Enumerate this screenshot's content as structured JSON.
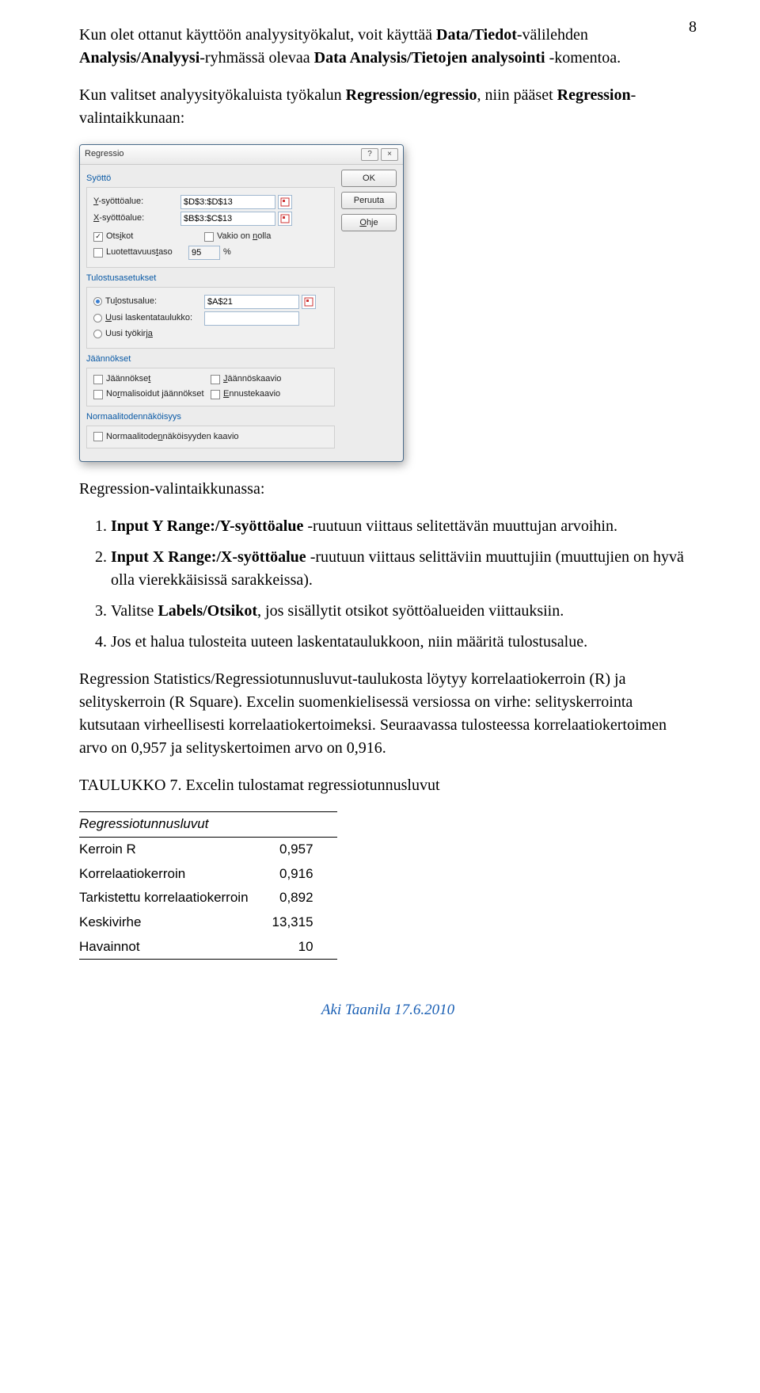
{
  "pageNumber": "8",
  "para1_a": "Kun olet ottanut käyttöön analyysityökalut, voit käyttää ",
  "para1_b": "Data/Tiedot",
  "para1_c": "-välilehden ",
  "para1_d": "Analysis/Analyysi",
  "para1_e": "-ryhmässä olevaa ",
  "para1_f": "Data Analysis/Tietojen analysointi",
  "para1_g": " -komentoa.",
  "para2_a": "Kun valitset analyysityökaluista työkalun ",
  "para2_b": "Regression/egressio",
  "para2_c": ", niin pääset ",
  "para2_d": "Regression",
  "para2_e": "-valintaikkunaan:",
  "dialog": {
    "title": "Regressio",
    "help": "?",
    "close": "×",
    "ok": "OK",
    "cancel": "Peruuta",
    "helpbtn": "Ohje",
    "section_input": "Syöttö",
    "yrange": "Y-syöttöalue:",
    "xrange": "X-syöttöalue:",
    "yval": "$D$3:$D$13",
    "xval": "$B$3:$C$13",
    "headers": "Otsikot",
    "const0": "Vakio on nolla",
    "conf": "Luotettavuustaso",
    "confval": "95",
    "pct": "%",
    "section_output": "Tulostusasetukset",
    "outrange": "Tulostusalue:",
    "outval": "$A$21",
    "newsheet": "Uusi laskentataulukko:",
    "newbook": "Uusi työkirja",
    "section_resid": "Jäännökset",
    "resid": "Jäännökset",
    "residplot": "Jäännöskaavio",
    "normresid": "Normalisoidut jäännökset",
    "fitplot": "Ennustekaavio",
    "section_norm": "Normaalitodennäköisyys",
    "normplot": "Normaalitodennäköisyyden kaavio"
  },
  "para3": "Regression-valintaikkunassa:",
  "li1_a": "Input Y Range:/Y-syöttöalue",
  "li1_b": " -ruutuun viittaus selitettävän muuttujan arvoihin.",
  "li2_a": "Input X Range:/X-syöttöalue",
  "li2_b": " -ruutuun viittaus selittäviin muuttujiin (muuttujien on hyvä olla vierekkäisissä sarakkeissa).",
  "li3_a": "Valitse ",
  "li3_b": "Labels/Otsikot",
  "li3_c": ", jos sisällytit otsikot syöttöalueiden viittauksiin.",
  "li4": "Jos et halua tulosteita uuteen laskentataulukkoon, niin määritä tulostusalue.",
  "para4": "Regression Statistics/Regressiotunnusluvut-taulukosta löytyy korrelaatiokerroin (R) ja selityskerroin (R Square). Excelin suomenkielisessä versiossa on virhe: selityskerrointa kutsutaan virheellisesti korrelaatiokertoimeksi. Seuraavassa tulosteessa korrelaatiokertoimen arvo on 0,957 ja selityskertoimen arvo on 0,916.",
  "para5": "TAULUKKO 7. Excelin tulostamat regressiotunnusluvut",
  "tbl": {
    "hdr": "Regressiotunnusluvut",
    "r1a": "Kerroin R",
    "r1b": "0,957",
    "r2a": "Korrelaatiokerroin",
    "r2b": "0,916",
    "r3a": "Tarkistettu korrelaatiokerroin",
    "r3b": "0,892",
    "r4a": "Keskivirhe",
    "r4b": "13,315",
    "r5a": "Havainnot",
    "r5b": "10"
  },
  "footer": "Aki Taanila 17.6.2010"
}
